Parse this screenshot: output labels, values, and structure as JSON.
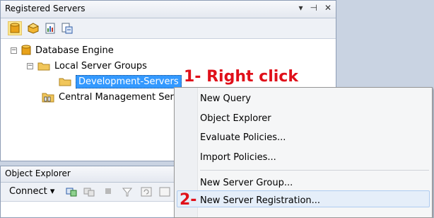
{
  "registered_servers": {
    "title": "Registered Servers",
    "title_buttons": [
      "▾",
      "⊣",
      "✕"
    ],
    "toolbar_icons": [
      "database-engine-icon",
      "analysis-services-icon",
      "reporting-services-icon",
      "integration-services-icon"
    ],
    "tree": {
      "database_engine": "Database Engine",
      "local_server_groups": "Local Server Groups",
      "development_servers": "Development-Servers",
      "central_management": "Central Management Ser"
    }
  },
  "object_explorer": {
    "title": "Object Explorer",
    "connect_label": "Connect ▾"
  },
  "context_menu": {
    "items": [
      "New Query",
      "Object Explorer",
      "Evaluate Policies...",
      "Import Policies...",
      "New Server Group...",
      "New Server Registration..."
    ]
  },
  "annotations": {
    "step1": "1- Right click",
    "step2": "2-"
  },
  "colors": {
    "selection": "#3399ff",
    "annotation": "#e0101a",
    "menu_hover": "#e5eef9"
  }
}
